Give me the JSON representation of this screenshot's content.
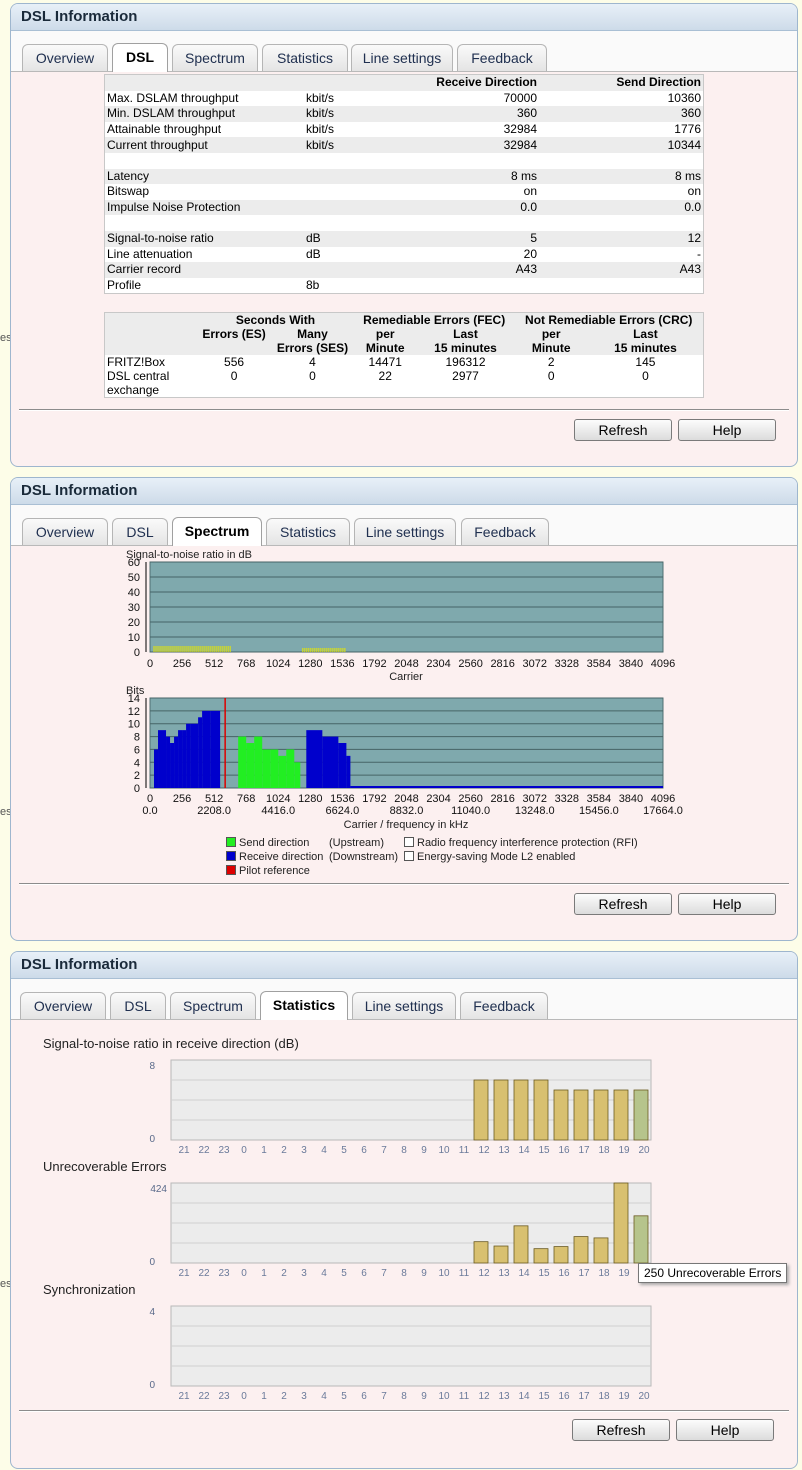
{
  "panel_title": "DSL Information",
  "tabs": [
    "Overview",
    "DSL",
    "Spectrum",
    "Statistics",
    "Line settings",
    "Feedback"
  ],
  "buttons": {
    "refresh": "Refresh",
    "help": "Help"
  },
  "side_char": "es",
  "dsl": {
    "header": {
      "receive": "Receive Direction",
      "send": "Send Direction"
    },
    "rows": [
      {
        "label": "Max. DSLAM throughput",
        "unit": "kbit/s",
        "rx": "70000",
        "tx": "10360"
      },
      {
        "label": "Min. DSLAM throughput",
        "unit": "kbit/s",
        "rx": "360",
        "tx": "360"
      },
      {
        "label": "Attainable throughput",
        "unit": "kbit/s",
        "rx": "32984",
        "tx": "1776"
      },
      {
        "label": "Current throughput",
        "unit": "kbit/s",
        "rx": "32984",
        "tx": "10344"
      },
      {
        "label": "",
        "unit": "",
        "rx": "",
        "tx": ""
      },
      {
        "label": "Latency",
        "unit": "",
        "rx": "8 ms",
        "tx": "8 ms"
      },
      {
        "label": "Bitswap",
        "unit": "",
        "rx": "on",
        "tx": "on"
      },
      {
        "label": "Impulse Noise Protection",
        "unit": "",
        "rx": "0.0",
        "tx": "0.0"
      },
      {
        "label": "",
        "unit": "",
        "rx": "",
        "tx": ""
      },
      {
        "label": "Signal-to-noise ratio",
        "unit": "dB",
        "rx": "5",
        "tx": "12"
      },
      {
        "label": "Line attenuation",
        "unit": "dB",
        "rx": "20",
        "tx": "-"
      },
      {
        "label": "Carrier record",
        "unit": "",
        "rx": "A43",
        "tx": "A43"
      },
      {
        "label": "Profile",
        "unit": "8b",
        "rx": "",
        "tx": ""
      }
    ],
    "errors": {
      "h_seconds": "Seconds With",
      "h_fec": "Remediable Errors (FEC)",
      "h_crc": "Not Remediable Errors (CRC)",
      "h_es": "Errors (ES)",
      "h_ses_1": "Many",
      "h_ses_2": "Errors (SES)",
      "h_per": "per",
      "h_minute": "Minute",
      "h_last": "Last",
      "h_15": "15 minutes",
      "rows": [
        {
          "label": "FRITZ!Box",
          "label2": "",
          "es": "556",
          "ses": "4",
          "fec_min": "14471",
          "fec_15": "196312",
          "crc_min": "2",
          "crc_15": "145"
        },
        {
          "label": "DSL central",
          "label2": "exchange",
          "es": "0",
          "ses": "0",
          "fec_min": "22",
          "fec_15": "2977",
          "crc_min": "0",
          "crc_15": "0"
        }
      ]
    }
  },
  "spectrum": {
    "snr_title": "Signal-to-noise ratio in dB",
    "bits_title": "Bits",
    "carrier_label": "Carrier",
    "freq_label": "Carrier / frequency in kHz",
    "carrier_ticks": [
      "0",
      "256",
      "512",
      "768",
      "1024",
      "1280",
      "1536",
      "1792",
      "2048",
      "2304",
      "2560",
      "2816",
      "3072",
      "3328",
      "3584",
      "3840",
      "4096"
    ],
    "freq_ticks": [
      "0.0",
      "2208.0",
      "4416.0",
      "6624.0",
      "8832.0",
      "11040.0",
      "13248.0",
      "15456.0",
      "17664.0"
    ],
    "snr_yticks": [
      "60",
      "50",
      "40",
      "30",
      "20",
      "10",
      "0"
    ],
    "bits_yticks": [
      "14",
      "12",
      "10",
      "8",
      "6",
      "4",
      "2",
      "0"
    ],
    "legend": {
      "send": "Send direction",
      "send_note": "(Upstream)",
      "receive": "Receive direction",
      "receive_note": "(Downstream)",
      "pilot": "Pilot reference",
      "rfi": "Radio frequency interference protection (RFI)",
      "l2": "Energy-saving Mode L2 enabled"
    },
    "colors": {
      "background": "#7fa9ad",
      "send": "#22ee22",
      "receive": "#0000cc",
      "pilot": "#dd0000",
      "snr_marks": "#e8e800"
    }
  },
  "statistics": {
    "hours": [
      "21",
      "22",
      "23",
      "0",
      "1",
      "2",
      "3",
      "4",
      "5",
      "6",
      "7",
      "8",
      "9",
      "10",
      "11",
      "12",
      "13",
      "14",
      "15",
      "16",
      "17",
      "18",
      "19",
      "20"
    ],
    "snr": {
      "title": "Signal-to-noise ratio in receive direction (dB)",
      "ymax_label": "8",
      "ymin_label": "0",
      "ymax": 8
    },
    "errors": {
      "title": "Unrecoverable Errors",
      "ymax_label": "424",
      "ymin_label": "0",
      "ymax": 424
    },
    "sync": {
      "title": "Synchronization",
      "ymax_label": "4",
      "ymin_label": "0",
      "ymax": 4
    },
    "tooltip": "250 Unrecoverable Errors"
  },
  "chart_data": [
    {
      "type": "bar",
      "title": "Signal-to-noise ratio in receive direction (dB)",
      "categories": [
        "21",
        "22",
        "23",
        "0",
        "1",
        "2",
        "3",
        "4",
        "5",
        "6",
        "7",
        "8",
        "9",
        "10",
        "11",
        "12",
        "13",
        "14",
        "15",
        "16",
        "17",
        "18",
        "19",
        "20"
      ],
      "values": [
        0,
        0,
        0,
        0,
        0,
        0,
        0,
        0,
        0,
        0,
        0,
        0,
        0,
        0,
        0,
        6,
        6,
        6,
        6,
        5,
        5,
        5,
        5,
        5
      ],
      "ylim": [
        0,
        8
      ],
      "highlight_last": true
    },
    {
      "type": "bar",
      "title": "Unrecoverable Errors",
      "categories": [
        "21",
        "22",
        "23",
        "0",
        "1",
        "2",
        "3",
        "4",
        "5",
        "6",
        "7",
        "8",
        "9",
        "10",
        "11",
        "12",
        "13",
        "14",
        "15",
        "16",
        "17",
        "18",
        "19",
        "20"
      ],
      "values": [
        0,
        0,
        0,
        0,
        0,
        0,
        0,
        0,
        0,
        0,
        0,
        0,
        0,
        0,
        0,
        113,
        90,
        197,
        76,
        87,
        140,
        133,
        424,
        250
      ],
      "ylim": [
        0,
        424
      ],
      "highlight_last": true
    },
    {
      "type": "bar",
      "title": "Synchronization",
      "categories": [
        "21",
        "22",
        "23",
        "0",
        "1",
        "2",
        "3",
        "4",
        "5",
        "6",
        "7",
        "8",
        "9",
        "10",
        "11",
        "12",
        "13",
        "14",
        "15",
        "16",
        "17",
        "18",
        "19",
        "20"
      ],
      "values": [
        0,
        0,
        0,
        0,
        0,
        0,
        0,
        0,
        0,
        0,
        0,
        0,
        0,
        0,
        0,
        0,
        0,
        0,
        0,
        0,
        0,
        0,
        0,
        0
      ],
      "ylim": [
        0,
        4
      ]
    },
    {
      "type": "bar",
      "title": "Bits",
      "x": [
        "0",
        "256",
        "512",
        "768",
        "1024",
        "1280",
        "1536",
        "1792",
        "2048",
        "2304",
        "2560",
        "2816",
        "3072",
        "3328",
        "3584",
        "3840",
        "4096"
      ],
      "series": [
        {
          "name": "Receive direction",
          "blocks": [
            [
              32,
              6
            ],
            [
              64,
              9
            ],
            [
              128,
              8
            ],
            [
              160,
              7
            ],
            [
              192,
              8
            ],
            [
              224,
              9
            ],
            [
              256,
              9
            ],
            [
              288,
              10
            ],
            [
              320,
              10
            ],
            [
              384,
              11
            ],
            [
              416,
              12
            ],
            [
              480,
              12
            ],
            [
              1248,
              9
            ],
            [
              1376,
              8
            ],
            [
              1504,
              7
            ],
            [
              1568,
              5
            ]
          ]
        },
        {
          "name": "Send direction",
          "blocks": [
            [
              704,
              8
            ],
            [
              768,
              7
            ],
            [
              832,
              8
            ],
            [
              896,
              6
            ],
            [
              960,
              6
            ],
            [
              1024,
              5
            ],
            [
              1088,
              6
            ],
            [
              1152,
              4
            ]
          ]
        },
        {
          "name": "Pilot reference",
          "carrier": 600
        }
      ],
      "ylim": [
        0,
        14
      ]
    }
  ]
}
